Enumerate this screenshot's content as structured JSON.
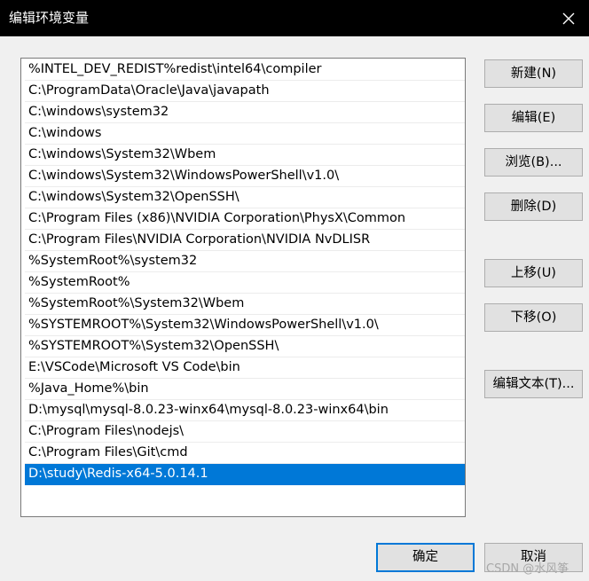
{
  "window": {
    "title": "编辑环境变量",
    "close_icon": "close-icon"
  },
  "paths": [
    "%INTEL_DEV_REDIST%redist\\intel64\\compiler",
    "C:\\ProgramData\\Oracle\\Java\\javapath",
    "C:\\windows\\system32",
    "C:\\windows",
    "C:\\windows\\System32\\Wbem",
    "C:\\windows\\System32\\WindowsPowerShell\\v1.0\\",
    "C:\\windows\\System32\\OpenSSH\\",
    "C:\\Program Files (x86)\\NVIDIA Corporation\\PhysX\\Common",
    "C:\\Program Files\\NVIDIA Corporation\\NVIDIA NvDLISR",
    "%SystemRoot%\\system32",
    "%SystemRoot%",
    "%SystemRoot%\\System32\\Wbem",
    "%SYSTEMROOT%\\System32\\WindowsPowerShell\\v1.0\\",
    "%SYSTEMROOT%\\System32\\OpenSSH\\",
    "E:\\VSCode\\Microsoft VS Code\\bin",
    "%Java_Home%\\bin",
    "D:\\mysql\\mysql-8.0.23-winx64\\mysql-8.0.23-winx64\\bin",
    "C:\\Program Files\\nodejs\\",
    "C:\\Program Files\\Git\\cmd",
    "D:\\study\\Redis-x64-5.0.14.1"
  ],
  "selected_index": 19,
  "buttons": {
    "new": "新建(N)",
    "edit": "编辑(E)",
    "browse": "浏览(B)...",
    "delete": "删除(D)",
    "move_up": "上移(U)",
    "move_down": "下移(O)",
    "edit_text": "编辑文本(T)...",
    "ok": "确定",
    "cancel": "取消"
  },
  "colors": {
    "selection": "#0078d7",
    "titlebar": "#000000"
  },
  "watermark": "CSDN @水风筝"
}
